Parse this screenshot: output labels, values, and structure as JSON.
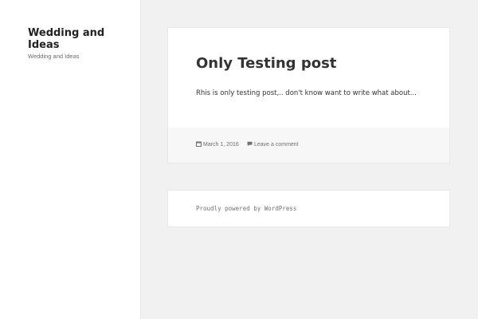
{
  "site": {
    "title": "Wedding and Ideas",
    "description": "Wedding and Ideas"
  },
  "post": {
    "title": "Only Testing post",
    "content": "Rhis is only testing post,.. don't know want to write what about...",
    "date": "March 1, 2016",
    "comment_link": "Leave a comment",
    "date_icon": "calendar-icon",
    "comment_icon": "comment-icon"
  },
  "footer": {
    "credit": "Proudly powered by WordPress"
  },
  "colors": {
    "page_background": "#f1f1f1",
    "panel_background": "#ffffff",
    "footer_band": "#f7f7f7",
    "text": "#333333",
    "muted_text": "#707070"
  }
}
